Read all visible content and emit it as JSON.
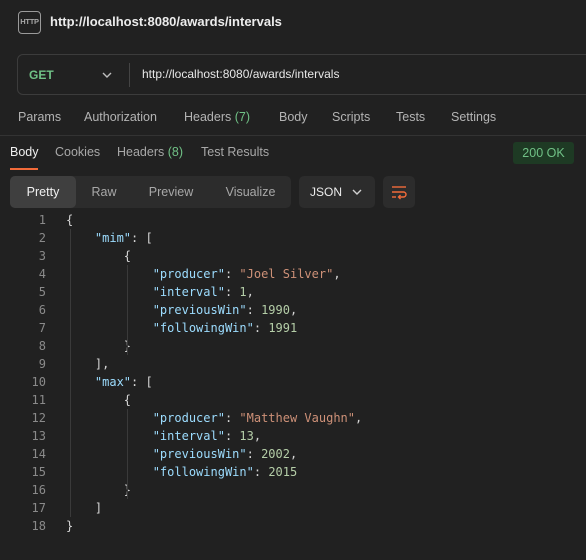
{
  "window": {
    "icon": "http-file-icon",
    "icon_text": "HTTP",
    "title": "http://localhost:8080/awards/intervals"
  },
  "request": {
    "method": "GET",
    "url": "http://localhost:8080/awards/intervals"
  },
  "request_tabs": [
    {
      "label": "Params"
    },
    {
      "label": "Authorization"
    },
    {
      "label": "Headers",
      "count": "(7)"
    },
    {
      "label": "Body"
    },
    {
      "label": "Scripts"
    },
    {
      "label": "Tests"
    },
    {
      "label": "Settings"
    }
  ],
  "response_tabs": [
    {
      "label": "Body"
    },
    {
      "label": "Cookies"
    },
    {
      "label": "Headers",
      "count": "(8)"
    },
    {
      "label": "Test Results"
    }
  ],
  "status": "200 OK",
  "view_modes": [
    "Pretty",
    "Raw",
    "Preview",
    "Visualize"
  ],
  "format": "JSON",
  "colors": {
    "accent": "#f26b3a",
    "success": "#70c186",
    "json_key": "#9cdcfe",
    "json_string": "#ce9178",
    "json_number": "#b5cea8"
  },
  "code_lines": [
    {
      "n": "1",
      "tokens": [
        [
          "punc",
          "{"
        ]
      ]
    },
    {
      "n": "2",
      "tokens": [
        [
          "punc",
          "    "
        ],
        [
          "key",
          "\"mim\""
        ],
        [
          "punc",
          ": ["
        ]
      ]
    },
    {
      "n": "3",
      "tokens": [
        [
          "punc",
          "        {"
        ]
      ]
    },
    {
      "n": "4",
      "tokens": [
        [
          "punc",
          "            "
        ],
        [
          "key",
          "\"producer\""
        ],
        [
          "punc",
          ": "
        ],
        [
          "str",
          "\"Joel Silver\""
        ],
        [
          "punc",
          ","
        ]
      ]
    },
    {
      "n": "5",
      "tokens": [
        [
          "punc",
          "            "
        ],
        [
          "key",
          "\"interval\""
        ],
        [
          "punc",
          ": "
        ],
        [
          "num",
          "1"
        ],
        [
          "punc",
          ","
        ]
      ]
    },
    {
      "n": "6",
      "tokens": [
        [
          "punc",
          "            "
        ],
        [
          "key",
          "\"previousWin\""
        ],
        [
          "punc",
          ": "
        ],
        [
          "num",
          "1990"
        ],
        [
          "punc",
          ","
        ]
      ]
    },
    {
      "n": "7",
      "tokens": [
        [
          "punc",
          "            "
        ],
        [
          "key",
          "\"followingWin\""
        ],
        [
          "punc",
          ": "
        ],
        [
          "num",
          "1991"
        ]
      ]
    },
    {
      "n": "8",
      "tokens": [
        [
          "punc",
          "        }"
        ]
      ]
    },
    {
      "n": "9",
      "tokens": [
        [
          "punc",
          "    ],"
        ]
      ]
    },
    {
      "n": "10",
      "tokens": [
        [
          "punc",
          "    "
        ],
        [
          "key",
          "\"max\""
        ],
        [
          "punc",
          ": ["
        ]
      ]
    },
    {
      "n": "11",
      "tokens": [
        [
          "punc",
          "        {"
        ]
      ]
    },
    {
      "n": "12",
      "tokens": [
        [
          "punc",
          "            "
        ],
        [
          "key",
          "\"producer\""
        ],
        [
          "punc",
          ": "
        ],
        [
          "str",
          "\"Matthew Vaughn\""
        ],
        [
          "punc",
          ","
        ]
      ]
    },
    {
      "n": "13",
      "tokens": [
        [
          "punc",
          "            "
        ],
        [
          "key",
          "\"interval\""
        ],
        [
          "punc",
          ": "
        ],
        [
          "num",
          "13"
        ],
        [
          "punc",
          ","
        ]
      ]
    },
    {
      "n": "14",
      "tokens": [
        [
          "punc",
          "            "
        ],
        [
          "key",
          "\"previousWin\""
        ],
        [
          "punc",
          ": "
        ],
        [
          "num",
          "2002"
        ],
        [
          "punc",
          ","
        ]
      ]
    },
    {
      "n": "15",
      "tokens": [
        [
          "punc",
          "            "
        ],
        [
          "key",
          "\"followingWin\""
        ],
        [
          "punc",
          ": "
        ],
        [
          "num",
          "2015"
        ]
      ]
    },
    {
      "n": "16",
      "tokens": [
        [
          "punc",
          "        }"
        ]
      ]
    },
    {
      "n": "17",
      "tokens": [
        [
          "punc",
          "    ]"
        ]
      ]
    },
    {
      "n": "18",
      "tokens": [
        [
          "punc",
          "}"
        ]
      ]
    }
  ]
}
